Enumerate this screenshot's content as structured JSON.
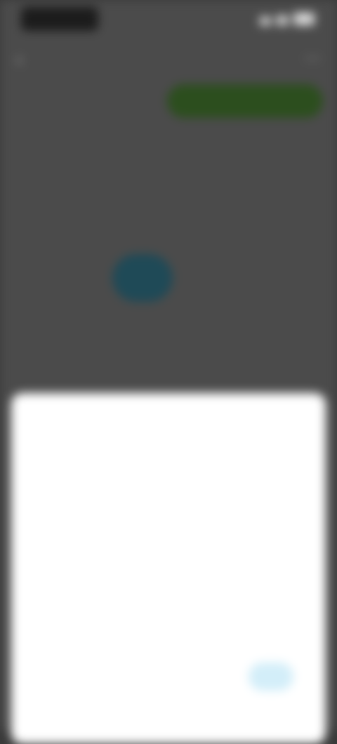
{
  "status_bar": {
    "time": "",
    "icons": [
      "signal-icon",
      "wifi-icon",
      "battery-icon"
    ]
  },
  "header": {
    "back_icon": "‹",
    "title": "",
    "more_icon": "⋯"
  },
  "row1": {
    "label": "",
    "button_label": ""
  },
  "row2": {
    "left_text": "",
    "right_text": ""
  },
  "row3": {
    "left_text": "",
    "right_text": ""
  },
  "profile": {
    "side_text": ""
  },
  "dialog": {
    "header_text": "",
    "message": "",
    "cancel_label": "",
    "confirm_label": ""
  },
  "colors": {
    "accent_green": "#2c4e1e",
    "avatar_teal": "#1f4a57",
    "dialog_confirm_bg": "#d3eef9",
    "overlay": "#4b4b4b"
  }
}
